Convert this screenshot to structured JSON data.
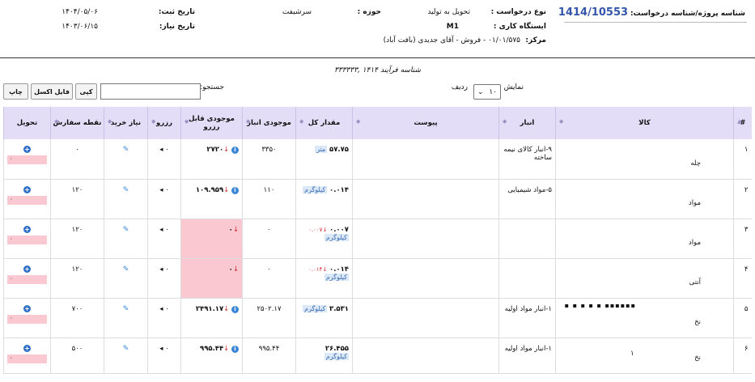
{
  "header": {
    "request_id_label": "شناسه پروژه/شناسه درخواست:",
    "request_id": "1414/10553",
    "request_type_label": "نوع درخواست :",
    "request_type": "تحویل به تولید",
    "domain_label": "حوزه :",
    "domain": "سرشیفت",
    "reg_date_label": "تاریخ ثبت:",
    "reg_date": "۱۴۰۴/۰۵/۰۶",
    "workstation_label": "ایستگاه کاری :",
    "workstation": "M1",
    "need_date_label": "تاریخ نیاز:",
    "need_date": "۱۴۰۳/۰۶/۱۵",
    "center_label": "مرکز:",
    "center": "۰۱/۰۱/۵۷۵ - فروش - آقای جدیدی (بافت آباد)"
  },
  "process_label": "شناسه فرآیند ۱۴۱۴ ,۳۳۳۳۳۳",
  "toolbar": {
    "show_label": "نمایش",
    "rows_value": "۱۰",
    "row_label": "ردیف",
    "search_label": "جستجو:",
    "copy": "کپی",
    "excel": "فایل اکسل",
    "print": "چاپ"
  },
  "columns": [
    "#",
    "کالا",
    "انبار",
    "پیوست",
    "مقدار کل",
    "موجودی انبار",
    "موجودی قابل رزرو",
    "رزرو",
    "نیاز خرید",
    "نقطه سفارش",
    "تحویل"
  ],
  "rows": [
    {
      "n": "۱",
      "item": "چله",
      "warehouse": "۹-انبار کالای نیمه ساخته",
      "qty": "۵۷.۷۵",
      "unit": "متر",
      "delta": "",
      "stock": "۳۳۵۰",
      "reservable": "۲۷۲۰",
      "reserve": "۰",
      "order_point": "۰",
      "deliver": "۰"
    },
    {
      "n": "۲",
      "item": "مواد",
      "warehouse": "۵-مواد شیمیایی",
      "qty": "۰.۰۱۴",
      "unit": "کیلوگرم",
      "delta": "",
      "stock": "۱۱۰",
      "reservable": "۱۰۹.۹۵۹",
      "reserve": "۰",
      "order_point": "۱۲۰",
      "deliver": "۰"
    },
    {
      "n": "۳",
      "item": "مواد",
      "warehouse": "",
      "qty": "۰.۰۰۷",
      "unit": "کیلوگرم",
      "delta": "۰.۰۰۷",
      "stock": "۰",
      "reservable": "۰",
      "reserve": "۰",
      "order_point": "۱۲۰",
      "deliver": "۰"
    },
    {
      "n": "۴",
      "item": "آنتی",
      "warehouse": "",
      "qty": "۰.۰۱۴",
      "unit": "کیلوگرم",
      "delta": "۰.۰۱۴",
      "stock": "۰",
      "reservable": "۰",
      "reserve": "۰",
      "order_point": "۱۲۰",
      "deliver": "۰"
    },
    {
      "n": "۵",
      "item": "نخ",
      "warehouse": "۱-انبار مواد اولیه",
      "qty": "۳.۵۳۱",
      "unit": "کیلوگرم",
      "delta": "",
      "stock": "۲۵۰۲.۱۷",
      "reservable": "۲۴۹۱.۱۷",
      "reserve": "۰",
      "order_point": "۷۰۰",
      "deliver": "۰"
    },
    {
      "n": "۶",
      "item": "نخ",
      "warehouse": "۱-انبار مواد اولیه",
      "qty": "۲۶.۴۵۵",
      "unit": "کیلوگرم",
      "delta": "",
      "stock": "۹۹۵.۴۴",
      "reservable": "۹۹۵.۴۴",
      "reserve": "۰",
      "order_point": "۵۰۰",
      "deliver": "۰"
    }
  ],
  "row6_extra": "۱"
}
